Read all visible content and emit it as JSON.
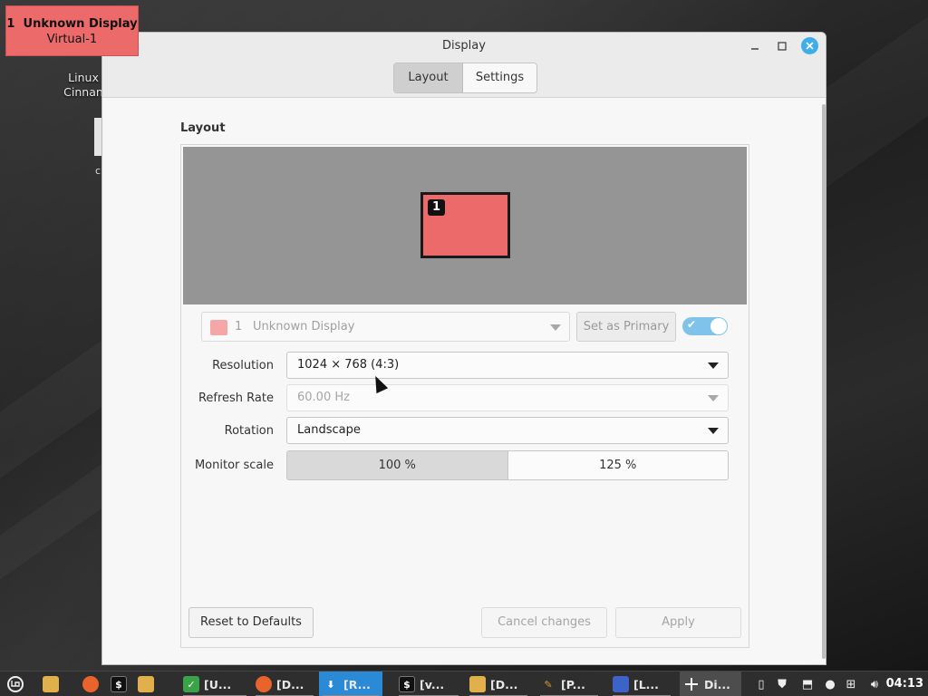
{
  "identify": {
    "number": "1",
    "title": "Unknown Display",
    "connector": "Virtual-1"
  },
  "desktop": {
    "icon_label_1": "Linux",
    "icon_label_2": "Cinnan",
    "small_text": "c"
  },
  "window": {
    "title": "Display",
    "tabs": [
      {
        "label": "Layout",
        "active": true
      },
      {
        "label": "Settings",
        "active": false
      }
    ],
    "section_title": "Layout",
    "monitor_badge": "1",
    "display_select": {
      "number": "1",
      "name": "Unknown Display",
      "swatch_color": "#f4a7a6"
    },
    "set_primary_label": "Set as Primary",
    "enabled_toggle": true,
    "rows": {
      "resolution": {
        "label": "Resolution",
        "value": "1024 × 768 (4:3)"
      },
      "refresh": {
        "label": "Refresh Rate",
        "value": "60.00 Hz"
      },
      "rotation": {
        "label": "Rotation",
        "value": "Landscape"
      },
      "scale": {
        "label": "Monitor scale",
        "options": [
          "100 %",
          "125 %"
        ],
        "selected": "100 %"
      }
    },
    "buttons": {
      "reset": "Reset to Defaults",
      "cancel": "Cancel changes",
      "apply": "Apply"
    }
  },
  "taskbar": {
    "items": [
      {
        "label": "[U...",
        "icon": "shield-vpn-icon",
        "color": "#3aa34a"
      },
      {
        "label": "[D...",
        "icon": "software-icon",
        "color": "#e8642c"
      },
      {
        "label": "[R...",
        "icon": "download-icon",
        "color": "#2b8ad6"
      },
      {
        "label": "[v...",
        "icon": "terminal-icon",
        "color": "#1a1a1a"
      },
      {
        "label": "[D...",
        "icon": "folder-icon",
        "color": "#e0b04c"
      },
      {
        "label": "[P...",
        "icon": "paint-icon",
        "color": "#d79b2c"
      },
      {
        "label": "[L...",
        "icon": "app-icon",
        "color": "#3d63c9"
      },
      {
        "label": "Di...",
        "icon": "display-icon",
        "color": "#ffffff"
      }
    ],
    "clock": "04:13",
    "accent": "#3daee9"
  }
}
